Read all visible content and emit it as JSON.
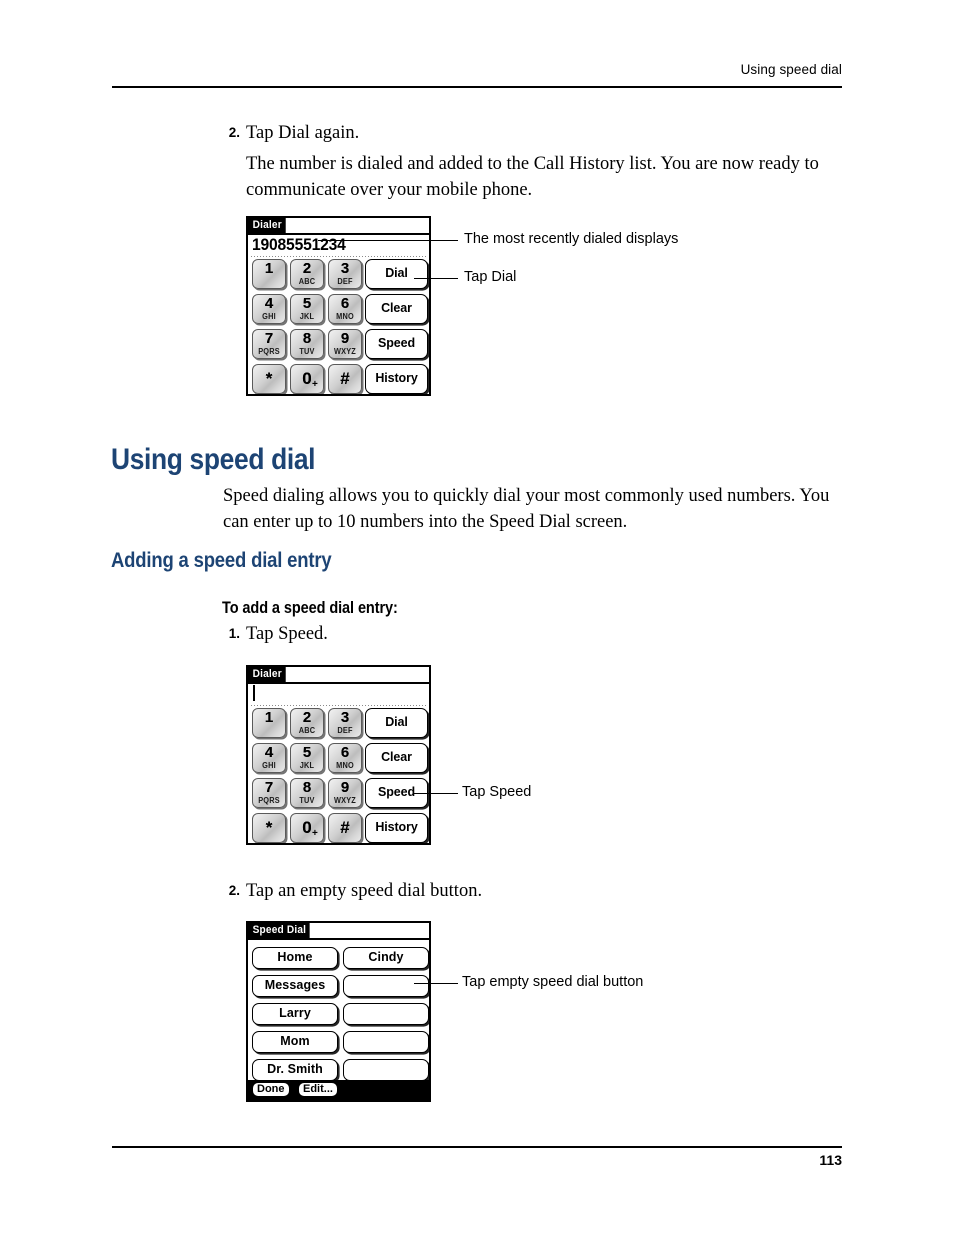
{
  "header": {
    "running_head": "Using speed dial"
  },
  "footer": {
    "page_number": "113"
  },
  "section_top": {
    "step2_num": "2.",
    "step2_text": "Tap Dial again.",
    "body_text": "The number is dialed and added to the Call History list. You are now ready to communicate over your mobile phone."
  },
  "headings": {
    "h1": "Using speed dial",
    "h1_body": "Speed dialing allows you to quickly dial your most commonly used numbers. You can enter up to 10 numbers into the Speed Dial screen.",
    "h2": "Adding a speed dial entry",
    "h3": "To add a speed dial entry:"
  },
  "section_add": {
    "step1_num": "1.",
    "step1_text": "Tap Speed.",
    "step2_num": "2.",
    "step2_text": "Tap an empty speed dial button."
  },
  "dialer": {
    "title": "Dialer",
    "number_value": "19085551234",
    "number_placeholder": "",
    "keys": [
      {
        "digit": "1",
        "letters": ""
      },
      {
        "digit": "2",
        "letters": "ABC"
      },
      {
        "digit": "3",
        "letters": "DEF"
      },
      {
        "digit": "4",
        "letters": "GHI"
      },
      {
        "digit": "5",
        "letters": "JKL"
      },
      {
        "digit": "6",
        "letters": "MNO"
      },
      {
        "digit": "7",
        "letters": "PQRS"
      },
      {
        "digit": "8",
        "letters": "TUV"
      },
      {
        "digit": "9",
        "letters": "WXYZ"
      },
      {
        "digit": "*",
        "letters": ""
      },
      {
        "digit": "0",
        "letters": "+"
      },
      {
        "digit": "#",
        "letters": ""
      }
    ],
    "function_buttons": [
      "Dial",
      "Clear",
      "Speed",
      "History"
    ]
  },
  "speed_dial": {
    "title": "Speed Dial",
    "entries_left": [
      "Home",
      "Messages",
      "Larry",
      "Mom",
      "Dr. Smith"
    ],
    "entries_right": [
      "Cindy",
      "",
      "",
      "",
      ""
    ],
    "done_label": "Done",
    "edit_label": "Edit..."
  },
  "callouts": {
    "c1": "The most recently dialed displays",
    "c2": "Tap Dial",
    "c3": "Tap Speed",
    "c4": "Tap empty speed dial button"
  },
  "colors": {
    "heading": "#1d4474",
    "rule": "#000000"
  }
}
